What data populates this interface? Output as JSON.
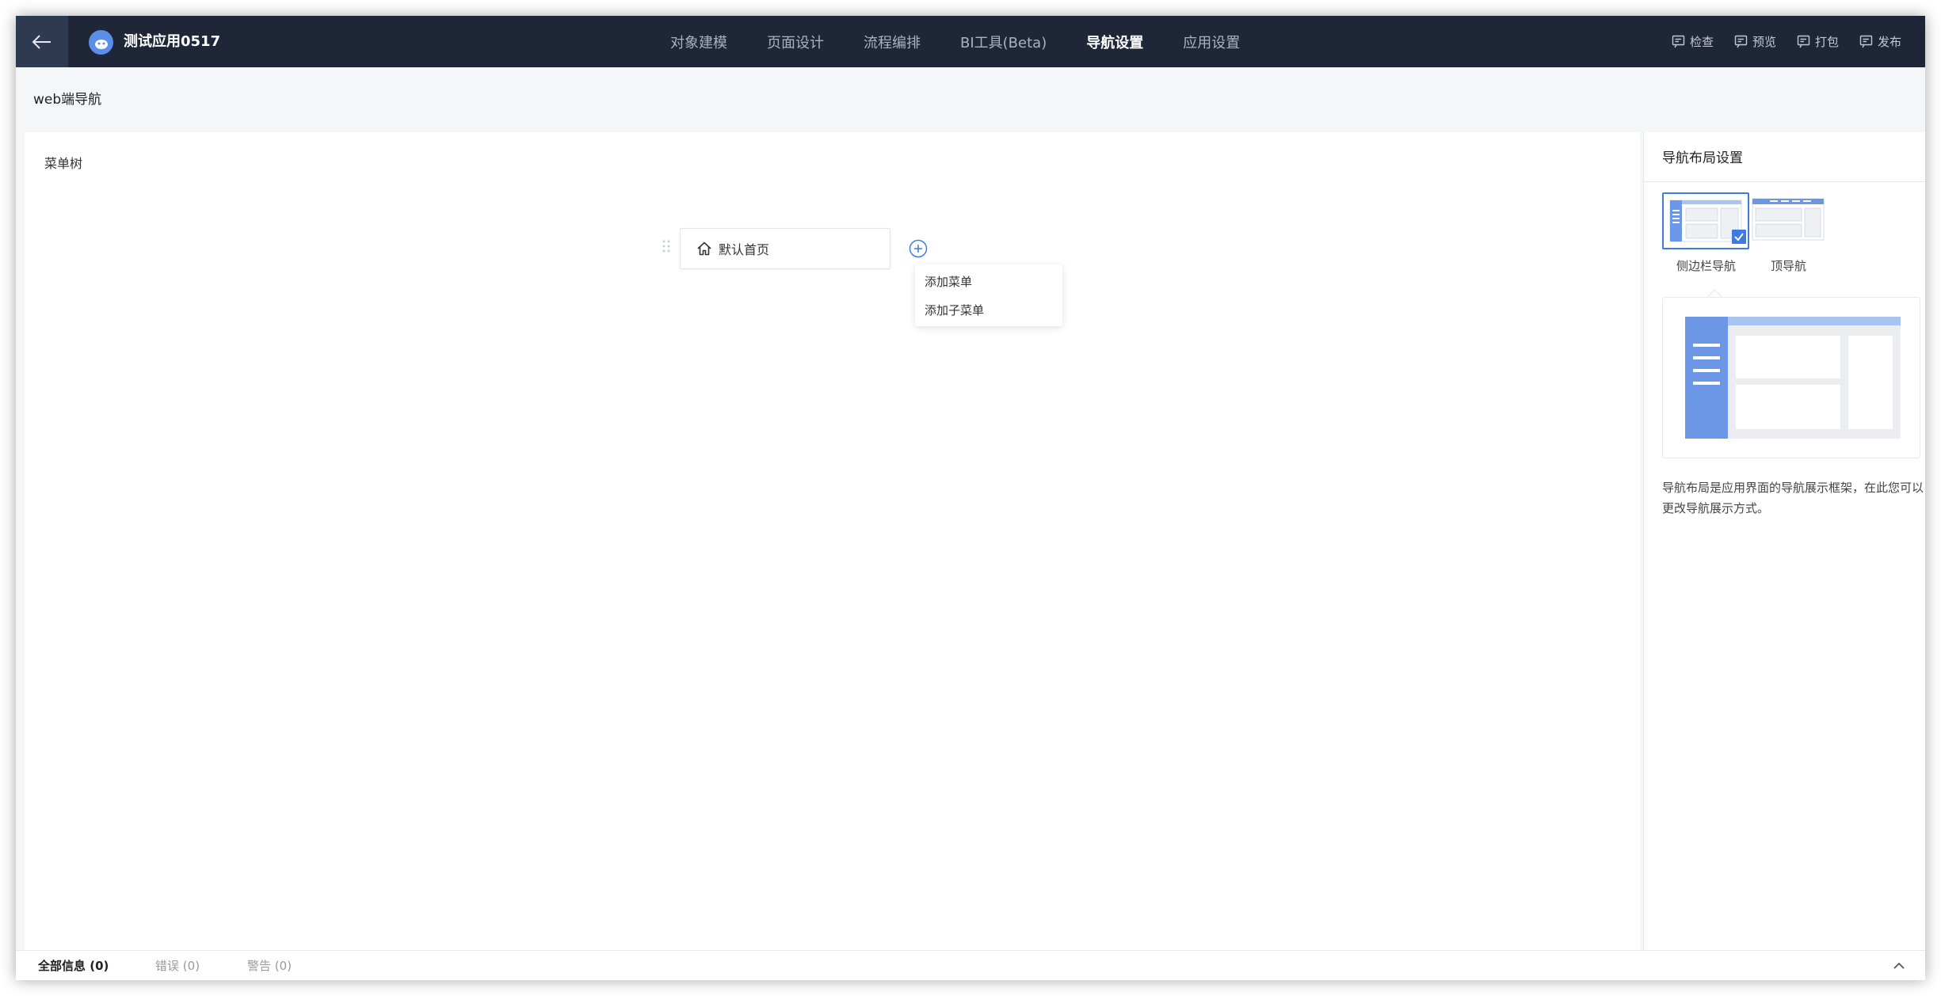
{
  "header": {
    "app_title": "测试应用0517",
    "tabs": [
      {
        "label": "对象建模"
      },
      {
        "label": "页面设计"
      },
      {
        "label": "流程编排"
      },
      {
        "label": "BI工具(Beta)"
      },
      {
        "label": "导航设置",
        "active": true
      },
      {
        "label": "应用设置"
      }
    ],
    "actions": [
      {
        "label": "检查",
        "icon": "check-icon"
      },
      {
        "label": "预览",
        "icon": "preview-icon"
      },
      {
        "label": "打包",
        "icon": "package-icon"
      },
      {
        "label": "发布",
        "icon": "publish-icon"
      }
    ]
  },
  "subheader": {
    "title": "web端导航"
  },
  "canvas": {
    "title": "菜单树",
    "node_label": "默认首页",
    "popup": {
      "items": [
        {
          "label": "添加菜单"
        },
        {
          "label": "添加子菜单"
        }
      ]
    }
  },
  "right_panel": {
    "title": "导航布局设置",
    "options": [
      {
        "label": "侧边栏导航",
        "selected": true
      },
      {
        "label": "顶导航",
        "selected": false
      }
    ],
    "description": "导航布局是应用界面的导航展示框架，在此您可以更改导航展示方式。"
  },
  "status_bar": {
    "tabs": [
      {
        "label": "全部信息",
        "count": "(0)"
      },
      {
        "label": "错误",
        "count": "(0)"
      },
      {
        "label": "警告",
        "count": "(0)"
      }
    ]
  },
  "colors": {
    "topbar_bg": "#1e2638",
    "accent": "#3e7be0",
    "preview_blue": "#6b97e6",
    "preview_light_blue": "#a9c4f0"
  }
}
